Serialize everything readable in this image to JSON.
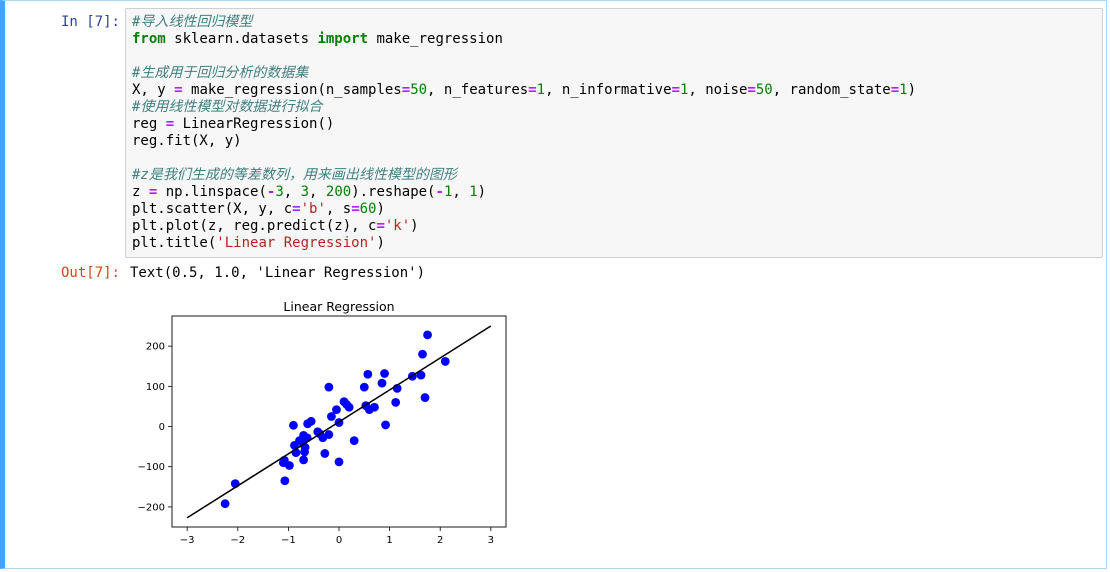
{
  "cell": {
    "in_prompt": "In [7]:",
    "out_prompt": "Out[7]:",
    "code_lines": [
      [
        {
          "t": "#导入线性回归模型",
          "c": "cm"
        }
      ],
      [
        {
          "t": "from",
          "c": "kw"
        },
        {
          "t": " sklearn.datasets "
        },
        {
          "t": "import",
          "c": "kw"
        },
        {
          "t": " make_regression"
        }
      ],
      [],
      [
        {
          "t": "#生成用于回归分析的数据集",
          "c": "cm"
        }
      ],
      [
        {
          "t": "X, y "
        },
        {
          "t": "=",
          "c": "op"
        },
        {
          "t": " make_regression(n_samples"
        },
        {
          "t": "=",
          "c": "op"
        },
        {
          "t": "50",
          "c": "nm"
        },
        {
          "t": ", n_features"
        },
        {
          "t": "=",
          "c": "op"
        },
        {
          "t": "1",
          "c": "nm"
        },
        {
          "t": ", n_informative"
        },
        {
          "t": "=",
          "c": "op"
        },
        {
          "t": "1",
          "c": "nm"
        },
        {
          "t": ", noise"
        },
        {
          "t": "=",
          "c": "op"
        },
        {
          "t": "50",
          "c": "nm"
        },
        {
          "t": ", random_state"
        },
        {
          "t": "=",
          "c": "op"
        },
        {
          "t": "1",
          "c": "nm"
        },
        {
          "t": ")"
        }
      ],
      [
        {
          "t": "#使用线性模型对数据进行拟合",
          "c": "cm"
        }
      ],
      [
        {
          "t": "reg "
        },
        {
          "t": "=",
          "c": "op"
        },
        {
          "t": " LinearRegression()"
        }
      ],
      [
        {
          "t": "reg.fit(X, y)"
        }
      ],
      [],
      [
        {
          "t": "#z是我们生成的等差数列，用来画出线性模型的图形",
          "c": "cm"
        }
      ],
      [
        {
          "t": "z "
        },
        {
          "t": "=",
          "c": "op"
        },
        {
          "t": " np.linspace("
        },
        {
          "t": "-",
          "c": "op"
        },
        {
          "t": "3",
          "c": "nm"
        },
        {
          "t": ", "
        },
        {
          "t": "3",
          "c": "nm"
        },
        {
          "t": ", "
        },
        {
          "t": "200",
          "c": "nm"
        },
        {
          "t": ").reshape("
        },
        {
          "t": "-",
          "c": "op"
        },
        {
          "t": "1",
          "c": "nm"
        },
        {
          "t": ", "
        },
        {
          "t": "1",
          "c": "nm"
        },
        {
          "t": ")"
        }
      ],
      [
        {
          "t": "plt.scatter(X, y, c"
        },
        {
          "t": "=",
          "c": "op"
        },
        {
          "t": "'b'",
          "c": "st"
        },
        {
          "t": ", s"
        },
        {
          "t": "=",
          "c": "op"
        },
        {
          "t": "60",
          "c": "nm"
        },
        {
          "t": ")"
        }
      ],
      [
        {
          "t": "plt.plot(z, reg.predict(z), c"
        },
        {
          "t": "=",
          "c": "op"
        },
        {
          "t": "'k'",
          "c": "st"
        },
        {
          "t": ")"
        }
      ],
      [
        {
          "t": "plt.title("
        },
        {
          "t": "'Linear Regression'",
          "c": "st"
        },
        {
          "t": ")"
        }
      ]
    ],
    "output_text": "Text(0.5, 1.0, 'Linear Regression')"
  },
  "chart_data": {
    "type": "scatter",
    "title": "Linear Regression",
    "xlabel": "",
    "ylabel": "",
    "xlim": [
      -3.3,
      3.3
    ],
    "ylim": [
      -250,
      275
    ],
    "xticks": [
      -3,
      -2,
      -1,
      0,
      1,
      2,
      3
    ],
    "yticks": [
      -200,
      -100,
      0,
      100,
      200
    ],
    "grid": false,
    "point_color": "#0000ff",
    "line_color": "#000000",
    "line": {
      "x": [
        -3,
        3
      ],
      "y": [
        -227,
        250
      ]
    },
    "points": [
      [
        -2.25,
        -192
      ],
      [
        -2.05,
        -142
      ],
      [
        -1.1,
        -90
      ],
      [
        -1.08,
        -84
      ],
      [
        -1.07,
        -135
      ],
      [
        -0.98,
        -97
      ],
      [
        -0.9,
        3
      ],
      [
        -0.88,
        -47
      ],
      [
        -0.85,
        -65
      ],
      [
        -0.78,
        -35
      ],
      [
        -0.72,
        -40
      ],
      [
        -0.7,
        -22
      ],
      [
        -0.7,
        -83
      ],
      [
        -0.68,
        -63
      ],
      [
        -0.67,
        -52
      ],
      [
        -0.63,
        -28
      ],
      [
        -0.62,
        7
      ],
      [
        -0.55,
        13
      ],
      [
        -0.42,
        -13
      ],
      [
        -0.38,
        -18
      ],
      [
        -0.32,
        -28
      ],
      [
        -0.28,
        -67
      ],
      [
        -0.2,
        -20
      ],
      [
        -0.2,
        98
      ],
      [
        -0.15,
        25
      ],
      [
        -0.05,
        42
      ],
      [
        0.0,
        -88
      ],
      [
        0.0,
        10
      ],
      [
        0.1,
        62
      ],
      [
        0.15,
        55
      ],
      [
        0.2,
        48
      ],
      [
        0.3,
        -35
      ],
      [
        0.5,
        98
      ],
      [
        0.53,
        52
      ],
      [
        0.57,
        130
      ],
      [
        0.6,
        42
      ],
      [
        0.7,
        48
      ],
      [
        0.85,
        108
      ],
      [
        0.9,
        132
      ],
      [
        0.92,
        4
      ],
      [
        1.12,
        60
      ],
      [
        1.15,
        95
      ],
      [
        1.45,
        125
      ],
      [
        1.62,
        128
      ],
      [
        1.65,
        180
      ],
      [
        1.7,
        72
      ],
      [
        1.75,
        228
      ],
      [
        2.1,
        162
      ]
    ]
  }
}
